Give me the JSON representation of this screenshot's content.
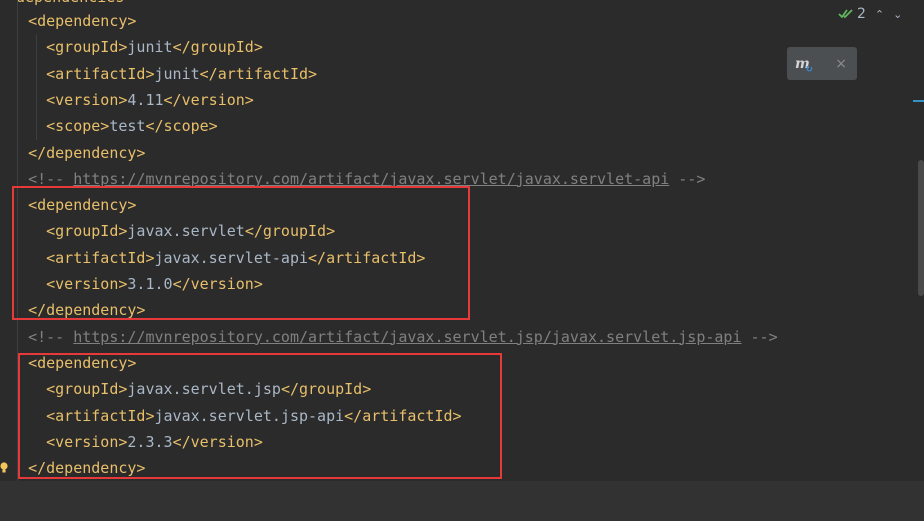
{
  "editor": {
    "top_clipped": "dependencies",
    "lines": [
      {
        "indent": "  ",
        "parts": [
          {
            "k": "tag",
            "t": "<dependency>"
          }
        ]
      },
      {
        "indent": "    ",
        "parts": [
          {
            "k": "tag",
            "t": "<groupId>"
          },
          {
            "k": "txt",
            "t": "junit"
          },
          {
            "k": "tag",
            "t": "</groupId>"
          }
        ]
      },
      {
        "indent": "    ",
        "parts": [
          {
            "k": "tag",
            "t": "<artifactId>"
          },
          {
            "k": "txt",
            "t": "junit"
          },
          {
            "k": "tag",
            "t": "</artifactId>"
          }
        ]
      },
      {
        "indent": "    ",
        "parts": [
          {
            "k": "tag",
            "t": "<version>"
          },
          {
            "k": "txt",
            "t": "4.11"
          },
          {
            "k": "tag",
            "t": "</version>"
          }
        ]
      },
      {
        "indent": "    ",
        "parts": [
          {
            "k": "tag",
            "t": "<scope>"
          },
          {
            "k": "txt",
            "t": "test"
          },
          {
            "k": "tag",
            "t": "</scope>"
          }
        ]
      },
      {
        "indent": "  ",
        "parts": [
          {
            "k": "tag",
            "t": "</dependency>"
          }
        ]
      },
      {
        "indent": "  ",
        "parts": [
          {
            "k": "cmt",
            "t": "<!-- "
          },
          {
            "k": "url",
            "t": "https://mvnrepository.com/artifact/javax.servlet/javax.servlet-api"
          },
          {
            "k": "cmt",
            "t": " -->"
          }
        ]
      },
      {
        "indent": "  ",
        "parts": [
          {
            "k": "tag",
            "t": "<dependency>"
          }
        ]
      },
      {
        "indent": "    ",
        "parts": [
          {
            "k": "tag",
            "t": "<groupId>"
          },
          {
            "k": "txt",
            "t": "javax.servlet"
          },
          {
            "k": "tag",
            "t": "</groupId>"
          }
        ]
      },
      {
        "indent": "    ",
        "parts": [
          {
            "k": "tag",
            "t": "<artifactId>"
          },
          {
            "k": "txt",
            "t": "javax.servlet-api"
          },
          {
            "k": "tag",
            "t": "</artifactId>"
          }
        ]
      },
      {
        "indent": "    ",
        "parts": [
          {
            "k": "tag",
            "t": "<version>"
          },
          {
            "k": "txt",
            "t": "3.1.0"
          },
          {
            "k": "tag",
            "t": "</version>"
          }
        ]
      },
      {
        "indent": "  ",
        "parts": [
          {
            "k": "tag",
            "t": "</dependency>"
          }
        ]
      },
      {
        "indent": "  ",
        "parts": [
          {
            "k": "cmt",
            "t": "<!-- "
          },
          {
            "k": "url",
            "t": "https://mvnrepository.com/artifact/javax.servlet.jsp/javax.servlet.jsp-api"
          },
          {
            "k": "cmt",
            "t": " -->"
          }
        ]
      },
      {
        "indent": "  ",
        "parts": [
          {
            "k": "tag",
            "t": "<dependency>"
          }
        ]
      },
      {
        "indent": "    ",
        "parts": [
          {
            "k": "tag",
            "t": "<groupId>"
          },
          {
            "k": "txt",
            "t": "javax.servlet.jsp"
          },
          {
            "k": "tag",
            "t": "</groupId>"
          }
        ]
      },
      {
        "indent": "    ",
        "parts": [
          {
            "k": "tag",
            "t": "<artifactId>"
          },
          {
            "k": "txt",
            "t": "javax.servlet.jsp-api"
          },
          {
            "k": "tag",
            "t": "</artifactId>"
          }
        ]
      },
      {
        "indent": "    ",
        "parts": [
          {
            "k": "tag",
            "t": "<version>"
          },
          {
            "k": "txt",
            "t": "2.3.3"
          },
          {
            "k": "tag",
            "t": "</version>"
          }
        ]
      },
      {
        "indent": "  ",
        "parts": [
          {
            "k": "tag",
            "t": "</dependency>"
          }
        ]
      }
    ]
  },
  "inspection": {
    "count": "2",
    "icon": "double-check-icon",
    "chevrons": [
      "up-chevron-icon",
      "down-chevron-icon"
    ]
  },
  "maven_popup": {
    "icon": "maven-reload-icon",
    "glyph": "m",
    "close": "×"
  },
  "colors": {
    "background": "#2b2b2b",
    "tag": "#e8bf6a",
    "text": "#a9b7c6",
    "comment": "#808080",
    "highlight_box": "#e5393a",
    "check": "#5fb85f"
  }
}
